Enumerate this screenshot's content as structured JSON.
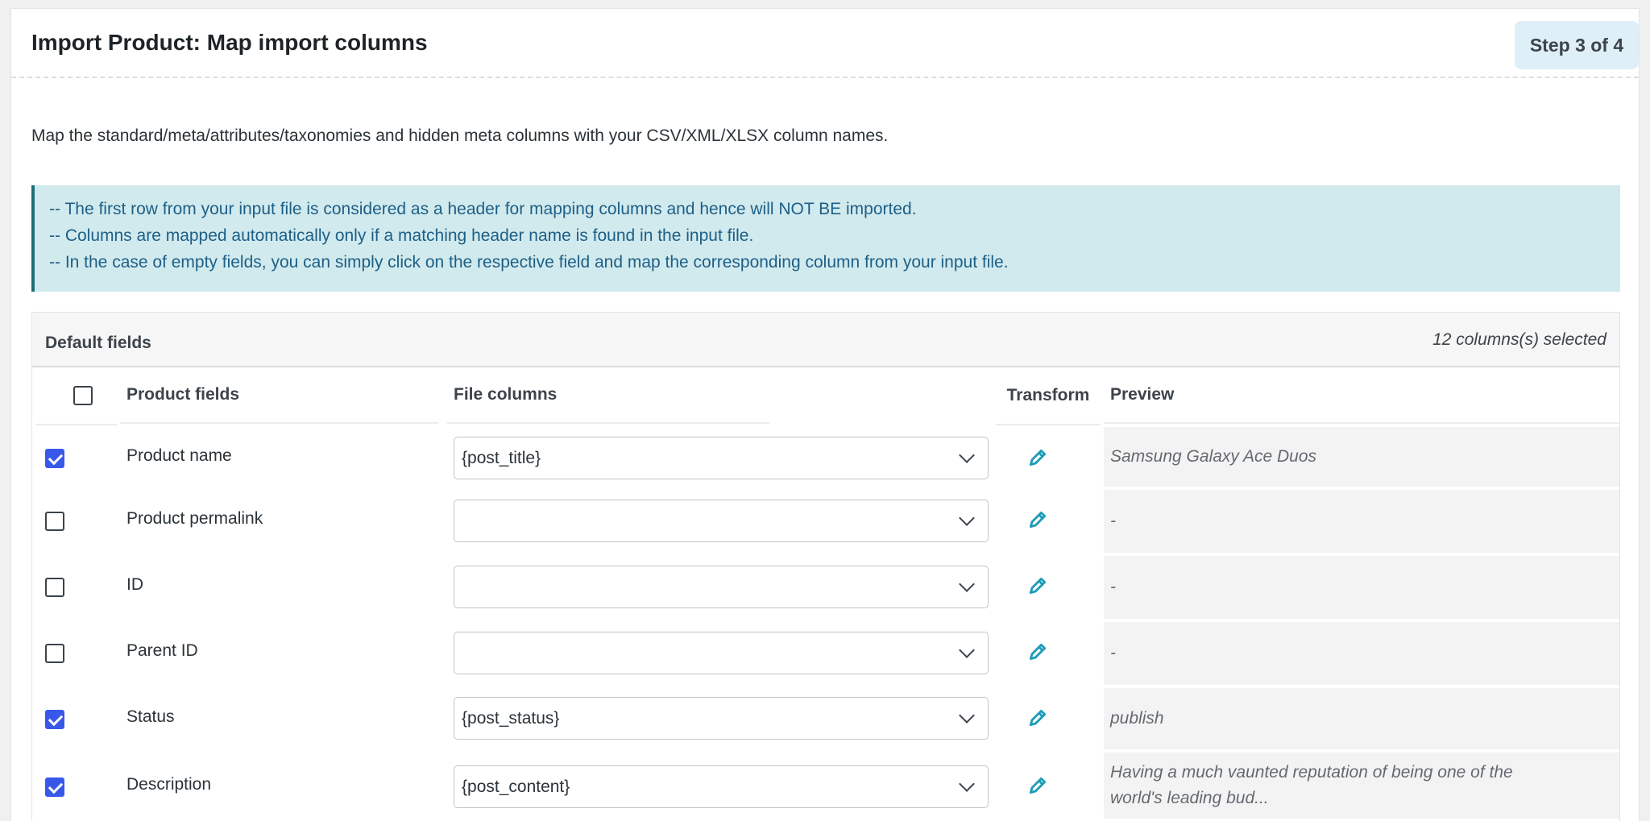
{
  "page": {
    "title": "Import Product: Map import columns",
    "step": "Step 3 of 4",
    "intro": "Map the standard/meta/attributes/taxonomies and hidden meta columns with your CSV/XML/XLSX column names."
  },
  "notice": {
    "lines": [
      "-- The first row from your input file is considered as a header for mapping columns and hence will NOT BE imported.",
      "-- Columns are mapped automatically only if a matching header name is found in the input file.",
      "-- In the case of empty fields, you can simply click on the respective field and map the corresponding column from your input file."
    ]
  },
  "fields": {
    "title": "Default fields",
    "count": "12 columns(s) selected",
    "headers": {
      "product_fields": "Product fields",
      "file_columns": "File columns",
      "transform": "Transform",
      "preview": "Preview"
    },
    "rows": [
      {
        "label": "Product name",
        "checked": true,
        "column": "{post_title}",
        "preview": "Samsung Galaxy Ace Duos"
      },
      {
        "label": "Product permalink",
        "checked": false,
        "column": "",
        "preview": "-"
      },
      {
        "label": "ID",
        "checked": false,
        "column": "",
        "preview": "-"
      },
      {
        "label": "Parent ID",
        "checked": false,
        "column": "",
        "preview": "-"
      },
      {
        "label": "Status",
        "checked": true,
        "column": "{post_status}",
        "preview": "publish"
      },
      {
        "label": "Description",
        "checked": true,
        "column": "{post_content}",
        "preview": "Having a much vaunted reputation of being one of the world's leading bud..."
      }
    ]
  },
  "colors": {
    "accent": "#3858e9",
    "pencil": "#1d9bb8",
    "notice_bg": "#d1eaee",
    "notice_text": "#1e5f86"
  },
  "icons": {
    "transform": "pencil-icon",
    "dropdown": "chevron-down-icon"
  }
}
